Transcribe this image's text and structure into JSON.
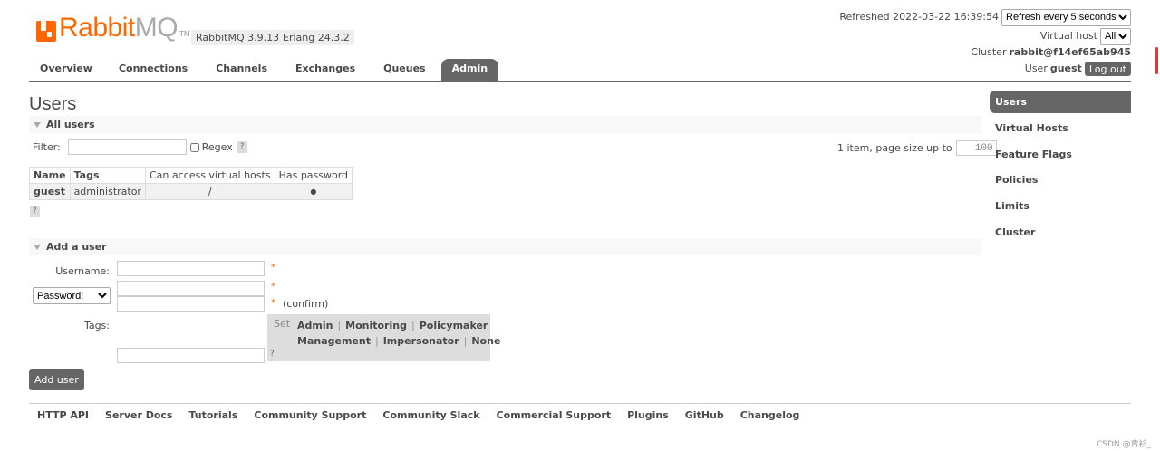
{
  "brand": {
    "rabbit": "Rabbit",
    "mq": "MQ",
    "tm": "TM",
    "version": "RabbitMQ 3.9.13",
    "erlang": "Erlang 24.3.2"
  },
  "topright": {
    "refreshed_label": "Refreshed 2022-03-22 16:39:54",
    "refresh_option": "Refresh every 5 seconds",
    "vhost_label": "Virtual host",
    "vhost_value": "All",
    "cluster_label": "Cluster",
    "cluster_value": "rabbit@f14ef65ab945",
    "user_label": "User",
    "user_value": "guest",
    "logout": "Log out"
  },
  "tabs": [
    "Overview",
    "Connections",
    "Channels",
    "Exchanges",
    "Queues",
    "Admin"
  ],
  "page_title": "Users",
  "all_users": {
    "section": "All users",
    "filter_label": "Filter:",
    "regex_label": "Regex",
    "help": "?",
    "pagination": "1 item, page size up to",
    "page_size": "100",
    "columns": [
      "Name",
      "Tags",
      "Can access virtual hosts",
      "Has password"
    ],
    "rows": [
      {
        "name": "guest",
        "tags": "administrator",
        "vhosts": "/",
        "has_password": "●"
      }
    ]
  },
  "add_user": {
    "section": "Add a user",
    "username_label": "Username:",
    "password_option": "Password:",
    "star": "*",
    "confirm": "(confirm)",
    "tags_label": "Tags:",
    "set": "Set",
    "tag_options": [
      "Admin",
      "Monitoring",
      "Policymaker",
      "Management",
      "Impersonator",
      "None"
    ],
    "button": "Add user"
  },
  "sidebar": [
    "Users",
    "Virtual Hosts",
    "Feature Flags",
    "Policies",
    "Limits",
    "Cluster"
  ],
  "footer": [
    "HTTP API",
    "Server Docs",
    "Tutorials",
    "Community Support",
    "Community Slack",
    "Commercial Support",
    "Plugins",
    "GitHub",
    "Changelog"
  ],
  "watermark": "CSDN @青衫_"
}
